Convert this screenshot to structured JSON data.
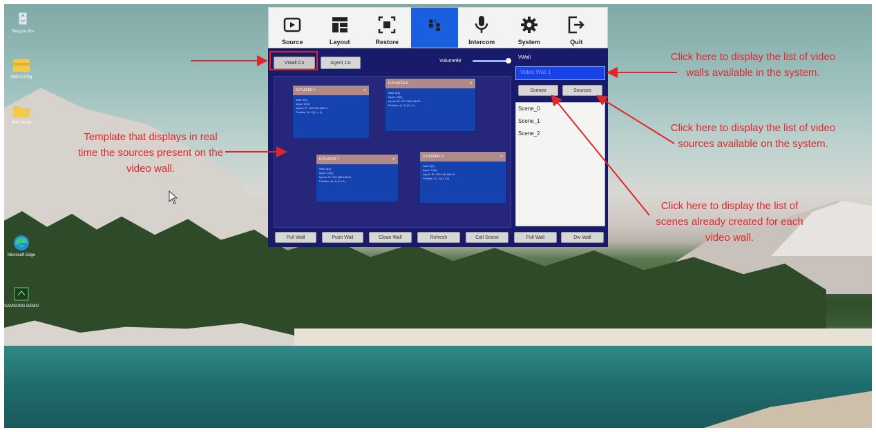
{
  "desktop": {
    "icons": [
      {
        "label": "Recycle Bin",
        "icon": "recycle-bin-icon"
      },
      {
        "label": "Wall Config",
        "icon": "folder-icon"
      },
      {
        "label": "Wall Setup",
        "icon": "folder-icon"
      },
      {
        "label": "Microsoft Edge",
        "icon": "edge-icon"
      },
      {
        "label": "SAMSUNG DEMO",
        "icon": "app-icon"
      }
    ]
  },
  "toolbar": {
    "items": [
      {
        "label": "Source",
        "icon": "play-icon"
      },
      {
        "label": "Layout",
        "icon": "layout-icon"
      },
      {
        "label": "Restore",
        "icon": "restore-icon"
      },
      {
        "label": "Cooperation",
        "icon": "users-icon"
      },
      {
        "label": "Intercom",
        "icon": "microphone-icon"
      },
      {
        "label": "System",
        "icon": "gear-icon"
      },
      {
        "label": "Quit",
        "icon": "exit-icon"
      }
    ],
    "active": "Cooperation"
  },
  "panel": {
    "tabs": [
      "VWall Co",
      "Agent Co"
    ],
    "volume_label": "Volume99",
    "volume_value": 0.99,
    "vwall_label": "VWall",
    "vwall_selected": "Video Wall 1",
    "scenes_button": "Scenes",
    "sources_button": "Sources",
    "scenes": [
      "Scene_0",
      "Scene_1",
      "Scene_2"
    ],
    "players": [
      {
        "title": "D-PLAYER 1",
        "info": "Wall: 0(0)\nInput: 19(1)\nInput's IP: 192.168.168.11\nPosition: (0, 0) (1 x 1)"
      },
      {
        "title": "D-PLAYER 6",
        "info": "Wall: 0(1)\nInput: 19(1)\nInput's IP: 192.168.168.24\nPosition: (1, 0) (1 x 1)"
      },
      {
        "title": "D-PLAYER 7",
        "info": "Wall: 0(2)\nInput: 19(1)\nInput's IP: 192.168.168.11\nPosition: (0, 1) (1 x 1)"
      },
      {
        "title": "D-PLAYER 11",
        "info": "Wall: 0(3)\nInput: 19(1)\nInput's IP: 192.168.168.16\nPosition: (1, 1) (1 x 1)"
      }
    ],
    "bottom_buttons": [
      "Pull Wall",
      "Push Wall",
      "Clean Wall",
      "Refresh",
      "Call Scene",
      "Full Wall",
      "Div Wall"
    ]
  },
  "annotations": {
    "template": "Template that displays in real time the sources present on the video wall.",
    "video_walls": "Click here to display the list of video walls available in the system.",
    "video_sources": "Click here to display the list of video sources available on the system.",
    "scenes": "Click here to display the list of scenes already created for each video wall."
  },
  "colors": {
    "accent": "#1a5fe0",
    "annotation": "#e0262a",
    "panel_bg": "#181a6a"
  }
}
